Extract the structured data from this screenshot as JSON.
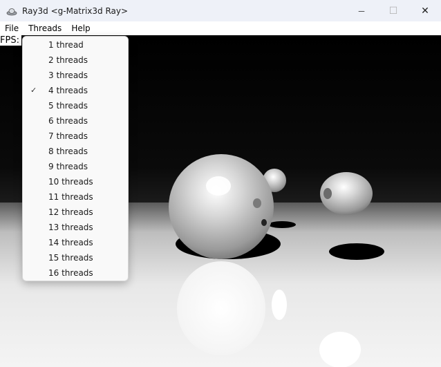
{
  "window": {
    "title": "Ray3d <g-Matrix3d Ray>",
    "minimize_glyph": "─",
    "maximize_glyph": "☐",
    "close_glyph": "✕"
  },
  "menubar": {
    "file": "File",
    "threads": "Threads",
    "help": "Help"
  },
  "overlay": {
    "fps_label": "FPS:"
  },
  "threads_menu": {
    "items": [
      {
        "label": "1 thread",
        "checked": false
      },
      {
        "label": "2 threads",
        "checked": false
      },
      {
        "label": "3 threads",
        "checked": false
      },
      {
        "label": "4 threads",
        "checked": true
      },
      {
        "label": "5 threads",
        "checked": false
      },
      {
        "label": "6 threads",
        "checked": false
      },
      {
        "label": "7 threads",
        "checked": false
      },
      {
        "label": "8 threads",
        "checked": false
      },
      {
        "label": "9 threads",
        "checked": false
      },
      {
        "label": "10 threads",
        "checked": false
      },
      {
        "label": "11 threads",
        "checked": false
      },
      {
        "label": "12 threads",
        "checked": false
      },
      {
        "label": "13 threads",
        "checked": false
      },
      {
        "label": "14 threads",
        "checked": false
      },
      {
        "label": "15 threads",
        "checked": false
      },
      {
        "label": "16 threads",
        "checked": false
      }
    ],
    "check_glyph": "✓"
  }
}
